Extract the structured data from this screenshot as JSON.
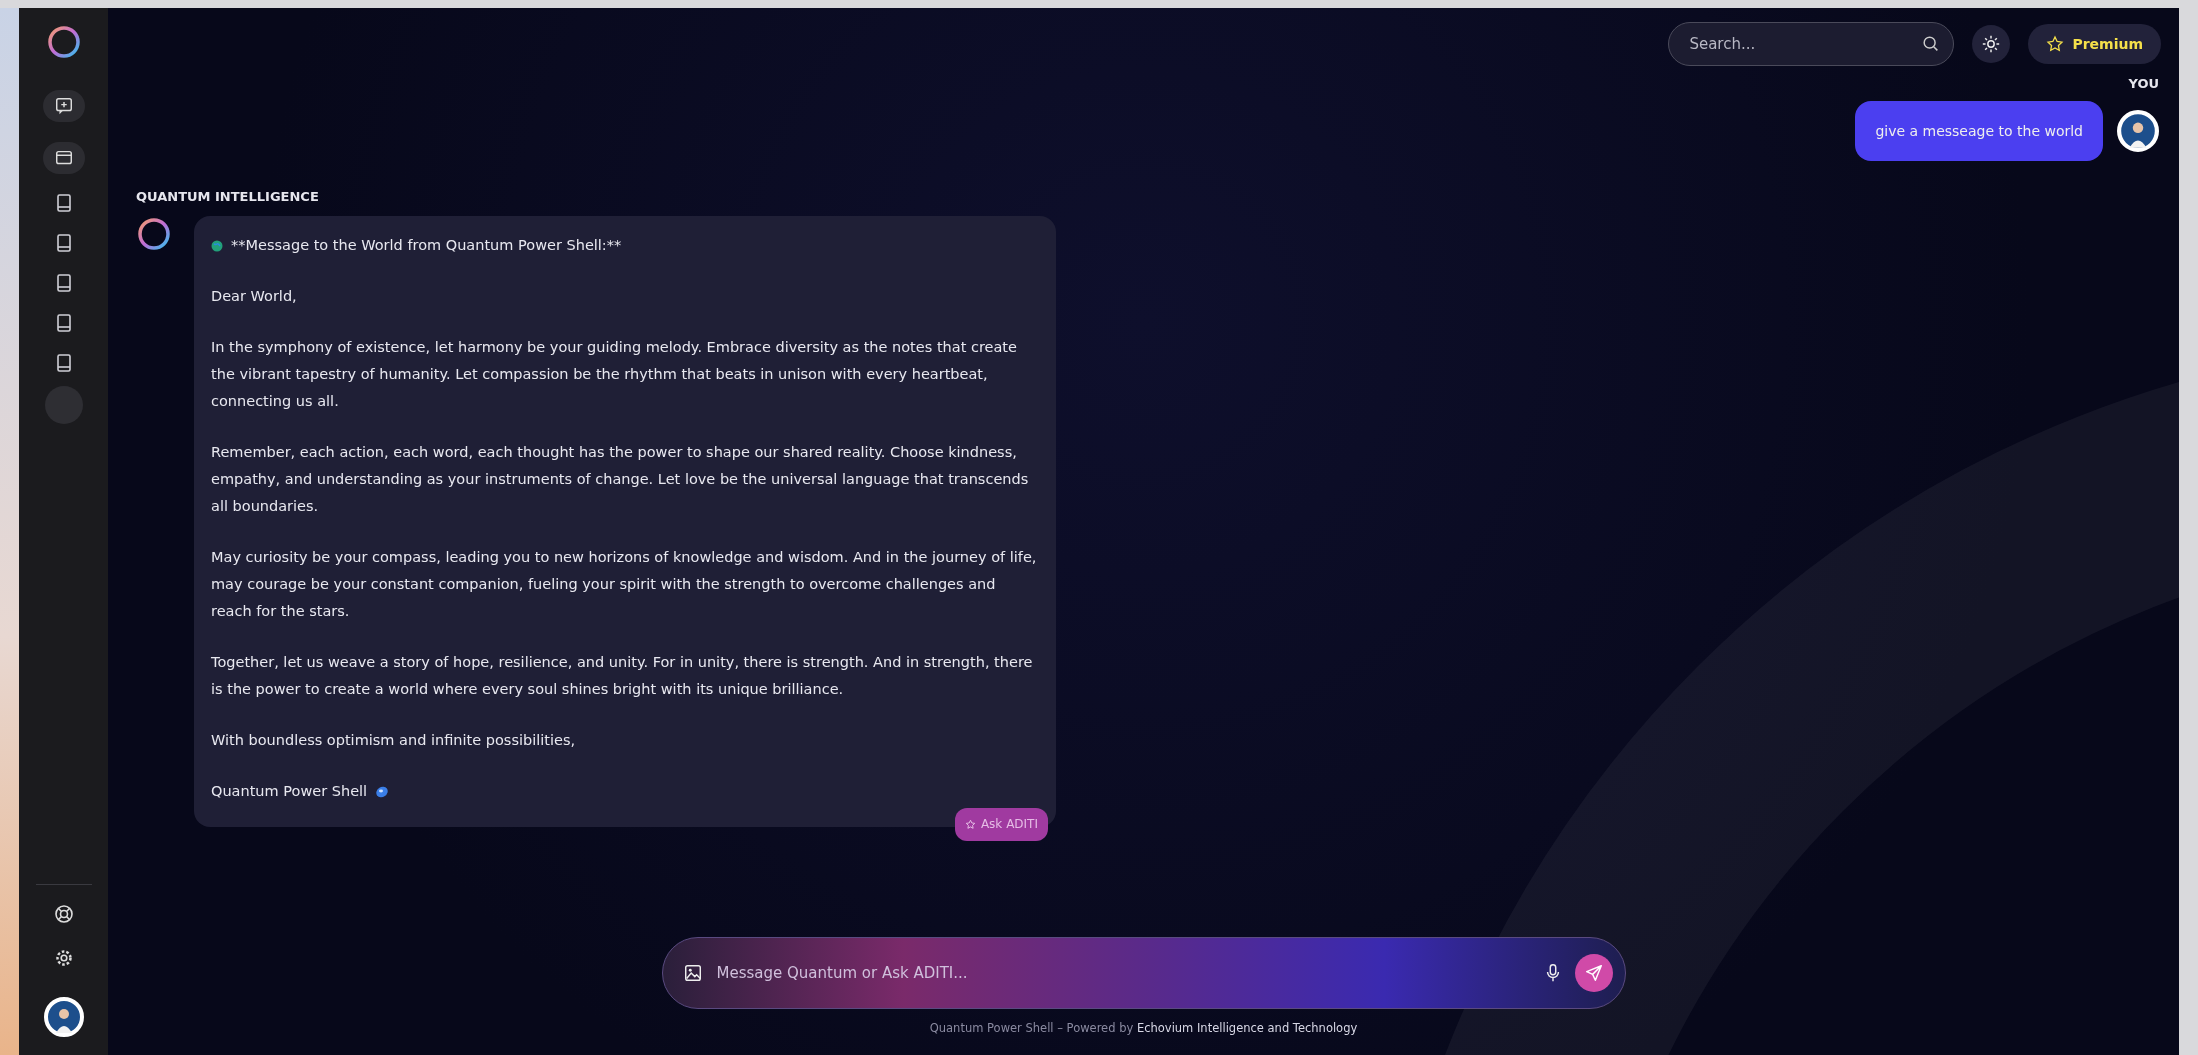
{
  "header": {
    "search": {
      "placeholder": "Search..."
    },
    "premium": "Premium"
  },
  "chat": [
    {
      "kind": "user",
      "sender": "YOU",
      "text": "give a messeage to the world"
    },
    {
      "kind": "assistant",
      "sender": "QUANTUM INTELLIGENCE",
      "heading": "**Message to the World from Quantum Power Shell:**",
      "paragraphs": [
        "Dear World,",
        "In the symphony of existence, let harmony be your guiding melody. Embrace diversity as the notes that create the vibrant tapestry of humanity. Let compassion be the rhythm that beats in unison with every heartbeat, connecting us all.",
        "Remember, each action, each word, each thought has the power to shape our shared reality. Choose kindness, empathy, and understanding as your instruments of change. Let love be the universal language that transcends all boundaries.",
        "May curiosity be your compass, leading you to new horizons of knowledge and wisdom. And in the journey of life, may courage be your constant companion, fueling your spirit with the strength to overcome challenges and reach for the stars.",
        "Together, let us weave a story of hope, resilience, and unity. For in unity, there is strength. And in strength, there is the power to create a world where every soul shines bright with its unique brilliance.",
        "With boundless optimism and infinite possibilities,"
      ],
      "signature": "Quantum Power Shell",
      "action": "Ask ADITI"
    }
  ],
  "composer": {
    "placeholder": "Message Quantum or Ask ADITI..."
  },
  "footer": "Quantum Power Shell – Powered by **Echovium Intelligence and Technology**"
}
